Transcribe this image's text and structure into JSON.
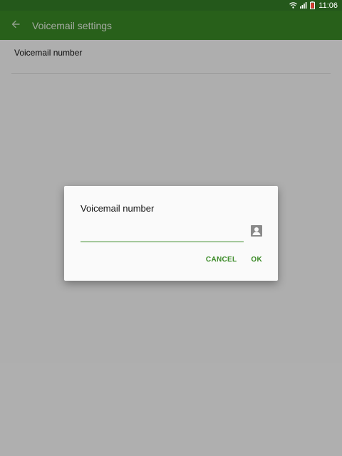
{
  "status_bar": {
    "time": "11:06",
    "icons": [
      "wifi-icon",
      "signal-icon",
      "battery-low-icon"
    ]
  },
  "app_bar": {
    "title": "Voicemail settings",
    "back_icon": "arrow-back-icon"
  },
  "settings": {
    "items": [
      {
        "label": "Voicemail number"
      }
    ]
  },
  "dialog": {
    "title": "Voicemail number",
    "input_value": "",
    "contact_icon": "contact-picker-icon",
    "cancel_label": "CANCEL",
    "ok_label": "OK"
  },
  "colors": {
    "status_bar": "#24581b",
    "app_bar": "#3a8a26",
    "accent": "#3a8a26",
    "scrim": "rgba(0,0,0,0.30)"
  }
}
